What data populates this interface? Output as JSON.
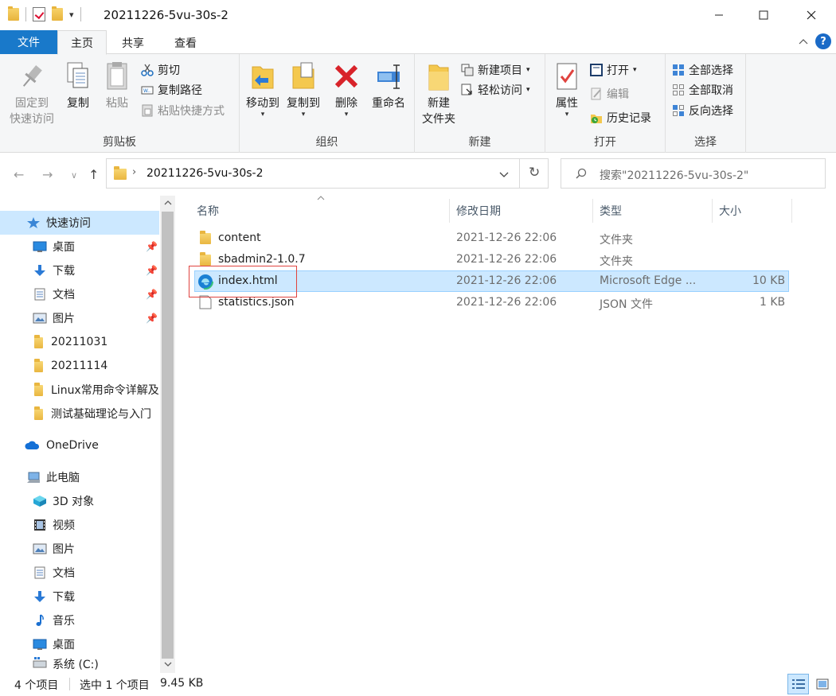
{
  "window": {
    "title": "20211226-5vu-30s-2"
  },
  "tabs": {
    "file": "文件",
    "home": "主页",
    "share": "共享",
    "view": "查看"
  },
  "ribbon": {
    "clipboard": {
      "label": "剪贴板",
      "pin": "固定到\n快速访问",
      "pin_l1": "固定到",
      "pin_l2": "快速访问",
      "copy": "复制",
      "paste": "粘贴",
      "cut": "剪切",
      "copy_path": "复制路径",
      "paste_shortcut": "粘贴快捷方式"
    },
    "organize": {
      "label": "组织",
      "move_to": "移动到",
      "copy_to": "复制到",
      "delete": "删除",
      "rename": "重命名"
    },
    "new": {
      "label": "新建",
      "new_folder_l1": "新建",
      "new_folder_l2": "文件夹",
      "new_item": "新建项目",
      "easy_access": "轻松访问"
    },
    "open": {
      "label": "打开",
      "properties": "属性",
      "open": "打开",
      "edit": "编辑",
      "history": "历史记录"
    },
    "select": {
      "label": "选择",
      "select_all": "全部选择",
      "select_none": "全部取消",
      "invert": "反向选择"
    }
  },
  "address": {
    "path": "20211226-5vu-30s-2",
    "search_placeholder": "搜索\"20211226-5vu-30s-2\""
  },
  "sidebar": {
    "quick_access": "快速访问",
    "items": [
      {
        "label": "桌面",
        "icon": "desktop-icon",
        "pinned": true
      },
      {
        "label": "下载",
        "icon": "download-icon",
        "pinned": true
      },
      {
        "label": "文档",
        "icon": "document-icon",
        "pinned": true
      },
      {
        "label": "图片",
        "icon": "picture-icon",
        "pinned": true
      },
      {
        "label": "20211031",
        "icon": "folder-icon"
      },
      {
        "label": "20211114",
        "icon": "folder-icon"
      },
      {
        "label": "Linux常用命令详解及",
        "icon": "folder-icon"
      },
      {
        "label": "测试基础理论与入门",
        "icon": "folder-icon"
      }
    ],
    "onedrive": "OneDrive",
    "this_pc": "此电脑",
    "pc_items": [
      {
        "label": "3D 对象",
        "icon": "3d-objects-icon"
      },
      {
        "label": "视频",
        "icon": "video-icon"
      },
      {
        "label": "图片",
        "icon": "picture-icon"
      },
      {
        "label": "文档",
        "icon": "document-icon"
      },
      {
        "label": "下载",
        "icon": "download-icon"
      },
      {
        "label": "音乐",
        "icon": "music-icon"
      },
      {
        "label": "桌面",
        "icon": "desktop-icon"
      },
      {
        "label": "系统 (C:)",
        "icon": "drive-icon"
      }
    ]
  },
  "columns": {
    "name": "名称",
    "date": "修改日期",
    "type": "类型",
    "size": "大小"
  },
  "files": [
    {
      "name": "content",
      "date": "2021-12-26 22:06",
      "type": "文件夹",
      "size": "",
      "icon": "folder-icon"
    },
    {
      "name": "sbadmin2-1.0.7",
      "date": "2021-12-26 22:06",
      "type": "文件夹",
      "size": "",
      "icon": "folder-icon"
    },
    {
      "name": "index.html",
      "date": "2021-12-26 22:06",
      "type": "Microsoft Edge ...",
      "size": "10 KB",
      "icon": "edge-icon",
      "selected": true
    },
    {
      "name": "statistics.json",
      "date": "2021-12-26 22:06",
      "type": "JSON 文件",
      "size": "1 KB",
      "icon": "file-icon"
    }
  ],
  "status": {
    "count": "4 个项目",
    "selected": "选中 1 个项目",
    "size": "9.45 KB"
  },
  "colors": {
    "accent": "#1979ca",
    "selection": "#cce8ff",
    "highlight_box": "#e0433f"
  }
}
